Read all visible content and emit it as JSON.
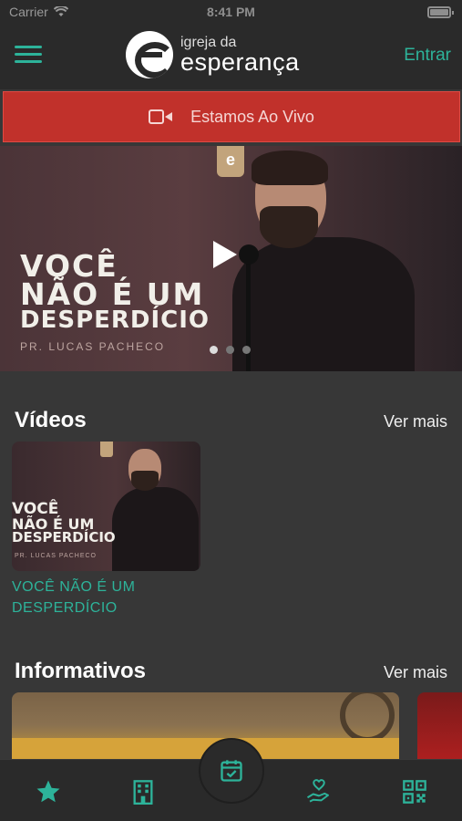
{
  "status_bar": {
    "carrier": "Carrier",
    "time": "8:41 PM"
  },
  "header": {
    "menu_icon": "hamburger-menu-icon",
    "logo_line1": "igreja da",
    "logo_line2": "esperança",
    "login_label": "Entrar"
  },
  "live_banner": {
    "icon": "video-camera-icon",
    "label": "Estamos Ao Vivo",
    "color": "#c1312b"
  },
  "hero": {
    "title_lines": [
      "VOCÊ",
      "NÃO É UM",
      "DESPERDÍCIO"
    ],
    "subtitle": "PR. LUCAS PACHECO",
    "badge": "e",
    "slides_total": 3,
    "active_slide": 1
  },
  "videos": {
    "title": "Vídeos",
    "more_label": "Ver mais",
    "items": [
      {
        "thumb_lines": [
          "VOCÊ",
          "NÃO É UM",
          "DESPERDÍCIO"
        ],
        "thumb_subtitle": "PR. LUCAS PACHECO",
        "caption": "VOCÊ NÃO É UM DESPERDÍCIO"
      }
    ]
  },
  "informativos": {
    "title": "Informativos",
    "more_label": "Ver mais"
  },
  "tabbar": {
    "items": [
      "star-icon",
      "building-icon",
      "calendar-check-icon",
      "hand-heart-icon",
      "qr-code-icon"
    ],
    "accent": "#2db39a"
  }
}
